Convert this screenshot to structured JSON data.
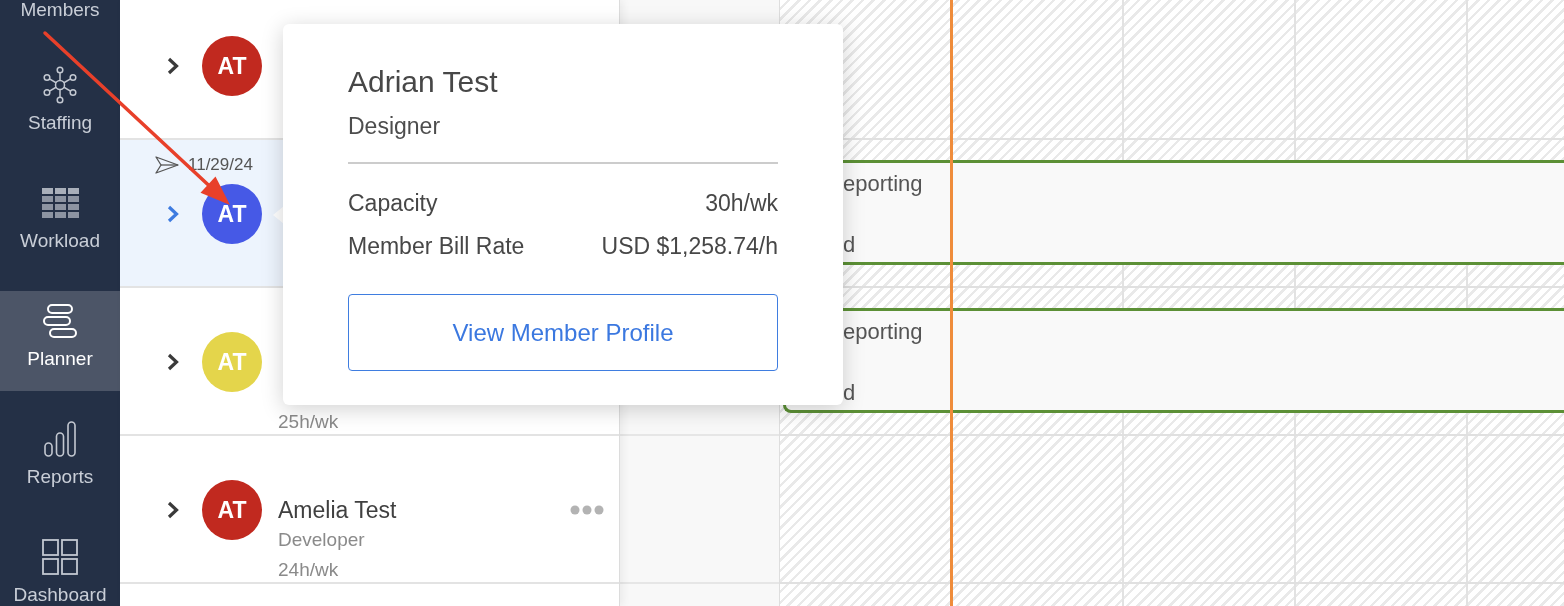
{
  "sidebar": {
    "items": [
      {
        "label": "Members",
        "selected": false
      },
      {
        "label": "Staffing",
        "selected": false
      },
      {
        "label": "Workload",
        "selected": false
      },
      {
        "label": "Planner",
        "selected": true
      },
      {
        "label": "Reports",
        "selected": false
      },
      {
        "label": "Dashboard",
        "selected": false
      }
    ]
  },
  "members": {
    "rows": [
      {
        "initials": "AT",
        "color": "#c1291f",
        "selected": false
      },
      {
        "date": "11/29/24",
        "initials": "AT",
        "color": "#4659e6",
        "selected": true
      },
      {
        "initials": "AT",
        "color": "#e4d54b",
        "selected": false,
        "capacity": "25h/wk"
      },
      {
        "initials": "AT",
        "color": "#c1291f",
        "selected": false,
        "name": "Amelia Test",
        "role": "Developer",
        "capacity": "24h/wk",
        "actions_menu": true
      }
    ]
  },
  "timeline": {
    "rows": [
      {
        "bar": null
      },
      {
        "bar": {
          "title": "eporting",
          "detail": "d"
        }
      },
      {
        "bar": {
          "title": "eporting",
          "detail": "d"
        }
      },
      {
        "bar": null
      }
    ]
  },
  "popover": {
    "name": "Adrian Test",
    "role": "Designer",
    "fields": [
      {
        "label": "Capacity",
        "value": "30h/wk"
      },
      {
        "label": "Member Bill Rate",
        "value": "USD $1,258.74/h"
      }
    ],
    "button": "View Member Profile"
  }
}
